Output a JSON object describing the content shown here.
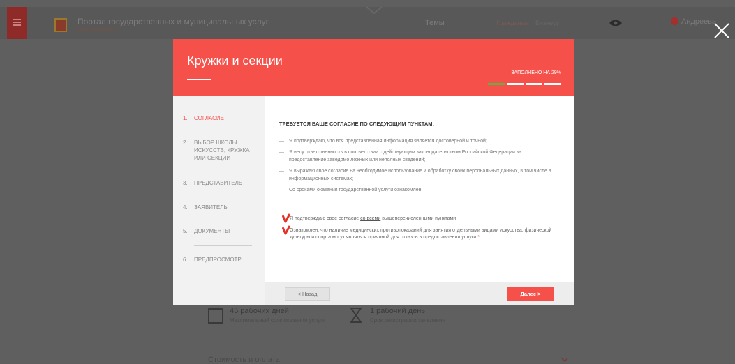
{
  "background": {
    "portal_title": "Портал государственных и муниципальных услуг",
    "portal_subtitle": "Московской области",
    "nav_themes": "Темы",
    "nav_citizens": "Гражданам",
    "nav_business": "Бизнесу",
    "user_name": "Андреева",
    "stat1_value": "45 рабочих дней",
    "stat1_caption": "Максимальный срок оказания услуги",
    "stat2_value": "1 рабочий день",
    "stat2_caption": "Срок регистрации заявления",
    "cost_heading": "Стоимость и оплата"
  },
  "modal": {
    "title": "Кружки и секции",
    "progress_label": "ЗАПОЛНЕНО НА 29%",
    "progress_percent": 29,
    "progress_segments": [
      true,
      false,
      false,
      false
    ],
    "steps": [
      {
        "num": "1.",
        "label": "СОГЛАСИЕ",
        "active": true
      },
      {
        "num": "2.",
        "label": "ВЫБОР ШКОЛЫ ИСКУССТВ, КРУЖКА ИЛИ СЕКЦИИ",
        "active": false
      },
      {
        "num": "3.",
        "label": "ПРЕДСТАВИТЕЛЬ",
        "active": false
      },
      {
        "num": "4.",
        "label": "ЗАЯВИТЕЛЬ",
        "active": false
      },
      {
        "num": "5.",
        "label": "ДОКУМЕНТЫ",
        "active": false
      },
      {
        "num": "6.",
        "label": "ПРЕДПРОСМОТР",
        "active": false
      }
    ],
    "heading": "ТРЕБУЕТСЯ ВАШЕ СОГЛАСИЕ ПО СЛЕДУЮЩИМ ПУНКТАМ:",
    "terms": [
      "Я подтверждаю, что вся представленная информация является достоверной и точной;",
      "Я несу ответственность в соответствии с действующим законодательством Российской Федерации за предоставление заведомо ложных или неполных сведений;",
      "Я выражаю свое согласие на необходимое использование и обработку своих персональных данных, в том числе в информационных системах;",
      "Со сроками оказания государственной услуги ознакомлен;"
    ],
    "consent1_before": "Я подтверждаю свое согласие ",
    "consent1_link": "со всеми",
    "consent1_after": " вышеперечисленными пунктами",
    "consent1_checked": true,
    "consent2_text": "Ознакомлен, что наличие медицинских противопоказаний для занятия отдельными видами искусства, физической культуры и спорта могут являться причиной для отказов в предоставлении услуги",
    "consent2_required_mark": "*",
    "consent2_checked": true,
    "back_label": "< Назад",
    "next_label": "Далее >"
  },
  "colors": {
    "accent": "#f5504a",
    "progress_done": "#63b045",
    "overlay": "#5f5f5f"
  }
}
